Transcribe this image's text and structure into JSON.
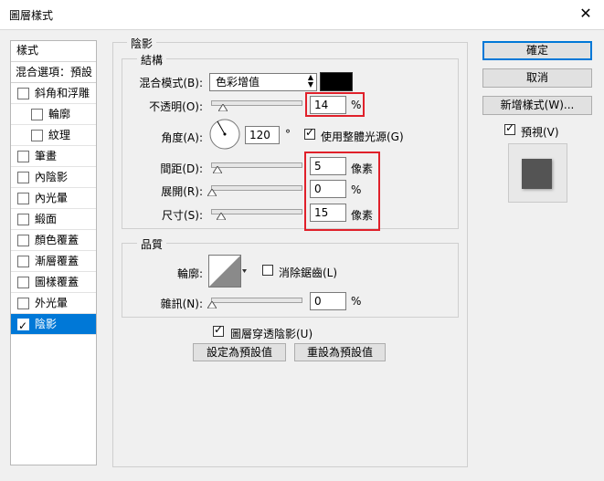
{
  "window": {
    "title": "圖層樣式",
    "close_glyph": "✕"
  },
  "left_panel": {
    "header": "樣式",
    "blend_options": "混合選項：預設",
    "items": [
      {
        "label": "斜角和浮雕",
        "checked": false,
        "indent": false
      },
      {
        "label": "輪廓",
        "checked": false,
        "indent": true
      },
      {
        "label": "紋理",
        "checked": false,
        "indent": true
      },
      {
        "label": "筆畫",
        "checked": false,
        "indent": false
      },
      {
        "label": "內陰影",
        "checked": false,
        "indent": false
      },
      {
        "label": "內光暈",
        "checked": false,
        "indent": false
      },
      {
        "label": "緞面",
        "checked": false,
        "indent": false
      },
      {
        "label": "顏色覆蓋",
        "checked": false,
        "indent": false
      },
      {
        "label": "漸層覆蓋",
        "checked": false,
        "indent": false
      },
      {
        "label": "圖樣覆蓋",
        "checked": false,
        "indent": false
      },
      {
        "label": "外光暈",
        "checked": false,
        "indent": false
      },
      {
        "label": "陰影",
        "checked": true,
        "indent": false,
        "selected": true
      }
    ]
  },
  "drop_shadow": {
    "title": "陰影",
    "structure": {
      "title": "結構",
      "blend_mode_label": "混合模式(B):",
      "blend_mode_value": "色彩增值",
      "blend_color": "#000000",
      "opacity_label": "不透明(O):",
      "opacity_value": "14",
      "opacity_unit": "%",
      "opacity_fraction": 0.14,
      "angle_label": "角度(A):",
      "angle_value": "120",
      "angle_unit": "°",
      "global_light_label": "使用整體光源(G)",
      "global_light_checked": true,
      "distance_label": "間距(D):",
      "distance_value": "5",
      "distance_unit": "像素",
      "spread_label": "展開(R):",
      "spread_value": "0",
      "spread_unit": "%",
      "size_label": "尺寸(S):",
      "size_value": "15",
      "size_unit": "像素"
    },
    "quality": {
      "title": "品質",
      "contour_label": "輪廓:",
      "anti_alias_label": "消除鋸齒(L)",
      "anti_alias_checked": false,
      "noise_label": "雜訊(N):",
      "noise_value": "0",
      "noise_unit": "%"
    },
    "knockout_label": "圖層穿透陰影(U)",
    "knockout_checked": true,
    "make_default": "設定為預設值",
    "reset_default": "重設為預設值"
  },
  "right": {
    "ok": "確定",
    "cancel": "取消",
    "new_style": "新增樣式(W)...",
    "preview_label": "預視(V)",
    "preview_checked": true
  },
  "colors": {
    "selection": "#0078d7",
    "highlight_box": "#e0202a"
  }
}
